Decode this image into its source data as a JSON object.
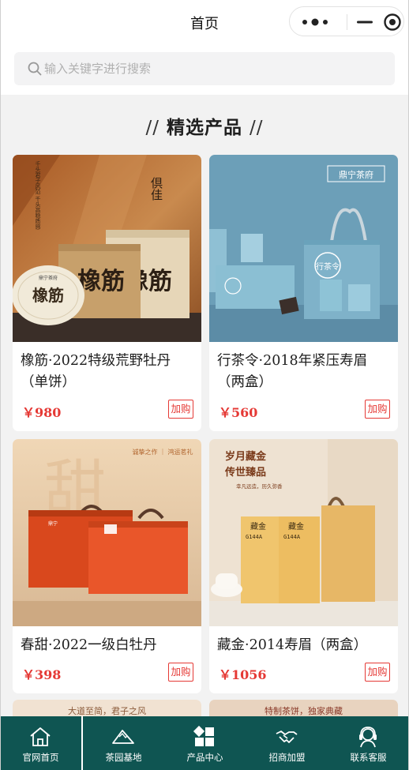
{
  "header": {
    "title": "首页",
    "capsule": {
      "more_icon": "more-dots-icon",
      "minimize_icon": "minus-icon",
      "close_icon": "target-icon"
    }
  },
  "search": {
    "placeholder": "输入关键字进行搜索",
    "value": "",
    "icon": "search-icon"
  },
  "section": {
    "title": "精选产品",
    "prefix": "//",
    "suffix": "//"
  },
  "products": [
    {
      "name": "橡筋·2022特级荒野牡丹（单饼）",
      "price": "￥980",
      "cart_label": "加购",
      "image_text": {
        "side": "倶佳",
        "vertical": "千头君子风范 千头高稳质感",
        "brand": "鼎宁茶府",
        "product": "橡筋"
      }
    },
    {
      "name": "行茶令·2018年紧压寿眉（两盒）",
      "price": "￥560",
      "cart_label": "加购",
      "image_text": {
        "brand": "鼎宁茶府",
        "product": "行茶令"
      }
    },
    {
      "name": "春甜·2022一级白牡丹",
      "price": "￥398",
      "cart_label": "加购",
      "image_text": {
        "top": "诚挚之作 ｜ 鸿运茗礼",
        "big": "甜",
        "brand": "鼎宁"
      }
    },
    {
      "name": "藏金·2014寿眉（两盒）",
      "price": "￥1056",
      "cart_label": "加购",
      "image_text": {
        "headline1": "岁月藏金",
        "headline2": "传世臻品",
        "sub": "幸凡远造，历久弥香",
        "box1": "藏金",
        "box2": "藏金",
        "code": "G144A"
      }
    }
  ],
  "teasers": [
    {
      "text": "大道至简，君子之风"
    },
    {
      "text": "特制茶饼，独家典藏"
    }
  ],
  "tabbar": {
    "items": [
      {
        "label": "官网首页",
        "icon": "home-icon"
      },
      {
        "label": "茶园基地",
        "icon": "mountain-icon"
      },
      {
        "label": "产品中心",
        "icon": "grid-icon"
      },
      {
        "label": "招商加盟",
        "icon": "handshake-icon"
      },
      {
        "label": "联系客服",
        "icon": "headset-icon"
      }
    ]
  },
  "colors": {
    "accent_red": "#e53935",
    "tabbar_bg": "#0f5552",
    "background": "#f2f2f2"
  }
}
